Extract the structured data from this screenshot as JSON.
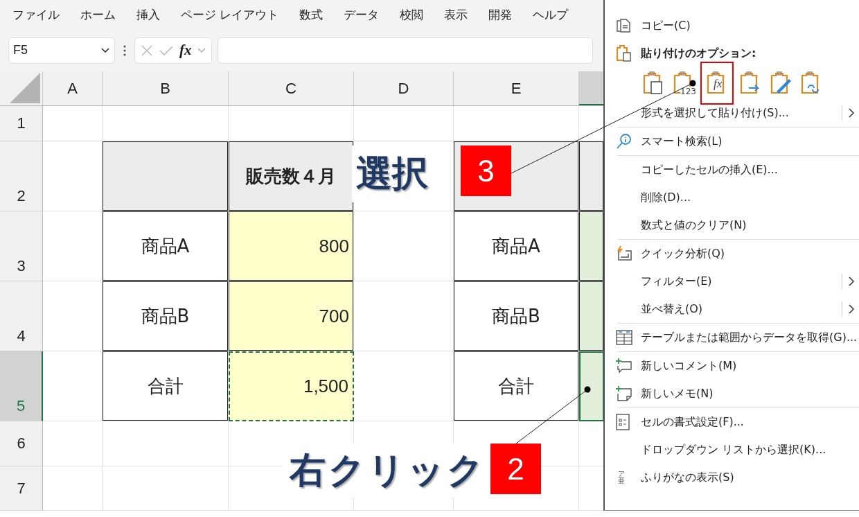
{
  "menu_bar": [
    "ファイル",
    "ホーム",
    "挿入",
    "ページ レイアウト",
    "数式",
    "データ",
    "校閲",
    "表示",
    "開発",
    "ヘルプ"
  ],
  "formula_bar": {
    "name_box": "F5",
    "function_label": "fx"
  },
  "sheet": {
    "columns": [
      {
        "label": "A",
        "selected": false
      },
      {
        "label": "B",
        "selected": false
      },
      {
        "label": "C",
        "selected": false
      },
      {
        "label": "D",
        "selected": false
      },
      {
        "label": "E",
        "selected": false
      },
      {
        "selected": true
      }
    ],
    "rows": [
      {
        "label": "1",
        "selected": false,
        "cells": [
          {
            "kind": "none"
          },
          {
            "kind": "none"
          },
          {
            "kind": "none"
          },
          {
            "kind": "none"
          },
          {
            "kind": "none"
          },
          {
            "kind": "none"
          }
        ]
      },
      {
        "label": "2",
        "selected": false,
        "cells": [
          {
            "kind": "none"
          },
          {
            "kind": "head"
          },
          {
            "kind": "head",
            "text": "販売数４月"
          },
          {
            "kind": "none"
          },
          {
            "kind": "head"
          },
          {
            "kind": "head"
          }
        ]
      },
      {
        "label": "3",
        "selected": false,
        "cells": [
          {
            "kind": "none"
          },
          {
            "kind": "label",
            "text": "商品A"
          },
          {
            "kind": "value",
            "text": "800"
          },
          {
            "kind": "none"
          },
          {
            "kind": "label",
            "text": "商品A"
          },
          {
            "kind": "green"
          }
        ]
      },
      {
        "label": "4",
        "selected": false,
        "cells": [
          {
            "kind": "none"
          },
          {
            "kind": "label",
            "text": "商品B"
          },
          {
            "kind": "value",
            "text": "700"
          },
          {
            "kind": "none"
          },
          {
            "kind": "label",
            "text": "商品B"
          },
          {
            "kind": "green"
          }
        ]
      },
      {
        "label": "5",
        "selected": true,
        "cells": [
          {
            "kind": "none"
          },
          {
            "kind": "label",
            "text": "合計"
          },
          {
            "kind": "copy",
            "text": "1,500"
          },
          {
            "kind": "none"
          },
          {
            "kind": "label",
            "text": "合計"
          },
          {
            "kind": "green_active"
          }
        ]
      },
      {
        "label": "6",
        "selected": false,
        "cells": [
          {
            "kind": "none"
          },
          {
            "kind": "none"
          },
          {
            "kind": "none"
          },
          {
            "kind": "none"
          },
          {
            "kind": "none"
          },
          {
            "kind": "none"
          }
        ]
      },
      {
        "label": "7",
        "selected": false,
        "cells": [
          {
            "kind": "none"
          },
          {
            "kind": "none"
          },
          {
            "kind": "none"
          },
          {
            "kind": "none"
          },
          {
            "kind": "none"
          },
          {
            "kind": "none"
          }
        ]
      }
    ]
  },
  "context_menu": [
    {
      "kind": "item",
      "label": "コピー(C)",
      "submenu": false
    },
    {
      "kind": "header",
      "label": "貼り付けのオプション:"
    },
    {
      "kind": "paste_options",
      "options": [
        {
          "highlighted": false
        },
        {
          "badge": "123",
          "highlighted": false
        },
        {
          "badge": "fx",
          "highlighted": true
        },
        {
          "highlighted": false
        },
        {
          "highlighted": false
        },
        {
          "highlighted": false
        }
      ]
    },
    {
      "kind": "item",
      "label": "形式を選択して貼り付け(S)...",
      "submenu": true
    },
    {
      "kind": "separator"
    },
    {
      "kind": "item",
      "label": "スマート検索(L)",
      "submenu": false
    },
    {
      "kind": "separator"
    },
    {
      "kind": "item",
      "label": "コピーしたセルの挿入(E)...",
      "submenu": false
    },
    {
      "kind": "item",
      "label": "削除(D)...",
      "submenu": false
    },
    {
      "kind": "item",
      "label": "数式と値のクリア(N)",
      "submenu": false
    },
    {
      "kind": "separator"
    },
    {
      "kind": "item",
      "label": "クイック分析(Q)",
      "submenu": false
    },
    {
      "kind": "item",
      "label": "フィルター(E)",
      "submenu": true
    },
    {
      "kind": "item",
      "label": "並べ替え(O)",
      "submenu": true
    },
    {
      "kind": "separator"
    },
    {
      "kind": "item",
      "label": "テーブルまたは範囲からデータを取得(G)...",
      "submenu": false
    },
    {
      "kind": "separator"
    },
    {
      "kind": "item",
      "label": "新しいコメント(M)",
      "submenu": false
    },
    {
      "kind": "item",
      "label": "新しいメモ(N)",
      "submenu": false
    },
    {
      "kind": "separator"
    },
    {
      "kind": "item",
      "label": "セルの書式設定(F)...",
      "submenu": false
    },
    {
      "kind": "item",
      "label": "ドロップダウン リストから選択(K)...",
      "submenu": false
    },
    {
      "kind": "item",
      "label": "ふりがなの表示(S)",
      "submenu": false,
      "icon_text": "ア亜"
    }
  ],
  "annotations": {
    "select_label": "選択",
    "step_3": "3",
    "right_click_label": "右クリック",
    "step_2": "2"
  }
}
